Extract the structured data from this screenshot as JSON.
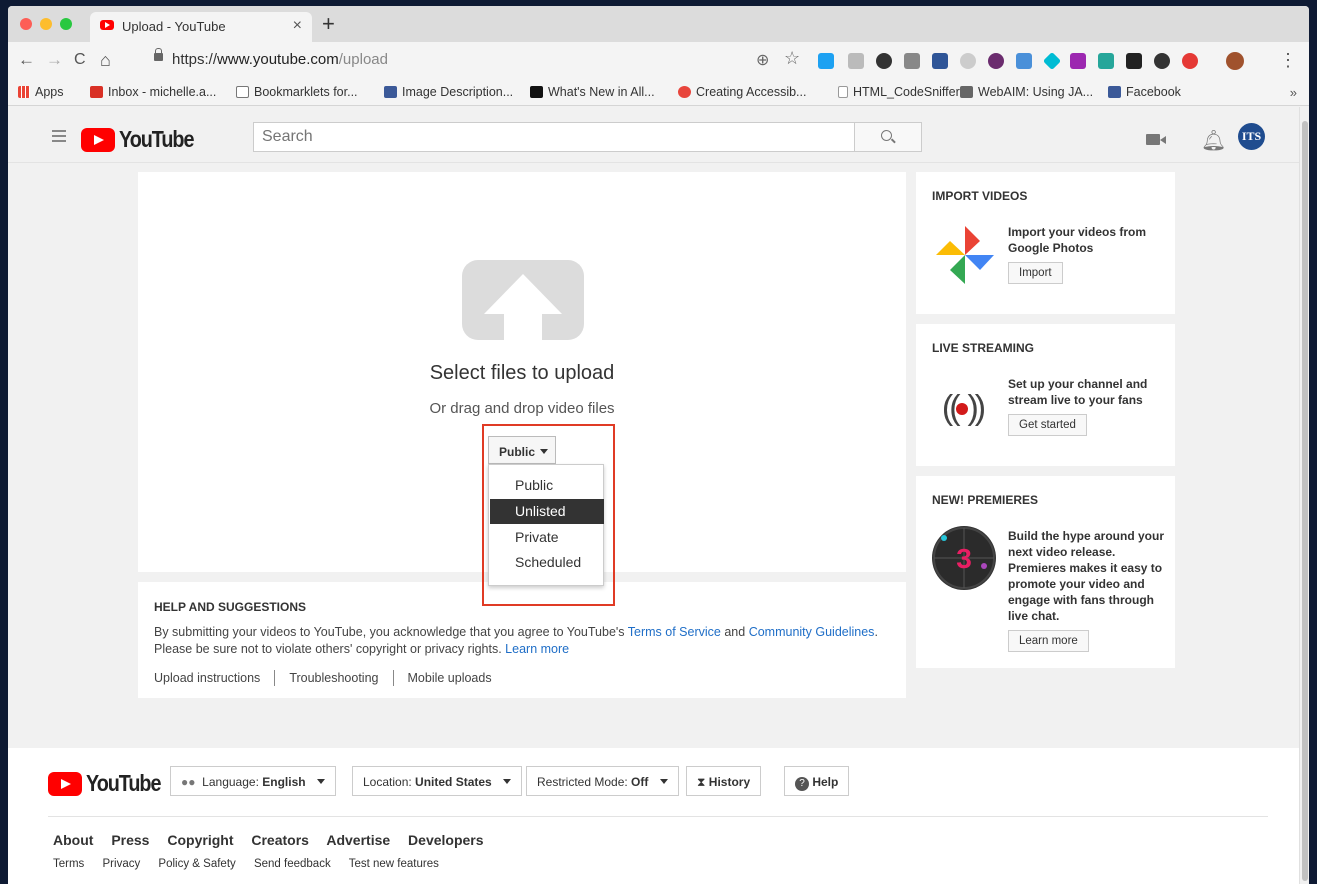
{
  "browser": {
    "tab_title": "Upload - YouTube",
    "tab_close": "×",
    "new_tab": "+",
    "url_scheme": "https://",
    "url_host": "www.youtube.com",
    "url_path": "/upload",
    "nav": {
      "back": "←",
      "forward": "→",
      "reload": "C",
      "home": "⌂"
    },
    "zoom_icon": "⊕",
    "star_icon": "☆",
    "menu_icon": "⋮",
    "bookmarks": [
      {
        "label": "Apps",
        "color": "#f4b400"
      },
      {
        "label": "Inbox - michelle.a...",
        "color": "#d93025"
      },
      {
        "label": "Bookmarklets for...",
        "color": "#888888"
      },
      {
        "label": "Image Description...",
        "color": "#3b5998"
      },
      {
        "label": "What's New in All...",
        "color": "#111111"
      },
      {
        "label": "Creating Accessib...",
        "color": "#e8453c"
      },
      {
        "label": "HTML_CodeSniffer",
        "color": "#aaaaaa"
      },
      {
        "label": "WebAIM: Using JA...",
        "color": "#666666"
      },
      {
        "label": "Facebook",
        "color": "#3b5998"
      }
    ],
    "bookmarks_more": "»"
  },
  "header": {
    "logo_text": "YouTube",
    "search_placeholder": "Search",
    "avatar_initials": "ITS"
  },
  "upload": {
    "title": "Select files to upload",
    "subtitle": "Or drag and drop video files",
    "privacy_selected": "Public",
    "privacy_options": [
      "Public",
      "Unlisted",
      "Private",
      "Scheduled"
    ],
    "highlighted_option": "Unlisted"
  },
  "help": {
    "title": "HELP AND SUGGESTIONS",
    "text_1": "By submitting your videos to YouTube, you acknowledge that you agree to YouTube's ",
    "terms_link": "Terms of Service",
    "text_and": " and ",
    "guidelines_link": "Community Guidelines",
    "text_end": ".",
    "text_2": "Please be sure not to violate others' copyright or privacy rights. ",
    "learn_more": "Learn more",
    "links": [
      "Upload instructions",
      "Troubleshooting",
      "Mobile uploads"
    ]
  },
  "sidebar": {
    "import": {
      "title": "IMPORT VIDEOS",
      "text": "Import your videos from Google Photos",
      "button": "Import"
    },
    "live": {
      "title": "LIVE STREAMING",
      "text": "Set up your channel and stream live to your fans",
      "button": "Get started"
    },
    "premieres": {
      "title": "NEW! PREMIERES",
      "text": "Build the hype around your next video release. Premieres makes it easy to promote your video and engage with fans through live chat.",
      "button": "Learn more",
      "badge_number": "3"
    }
  },
  "footer": {
    "logo_text": "YouTube",
    "language_label": "Language: ",
    "language_value": "English",
    "location_label": "Location: ",
    "location_value": "United States",
    "restricted_label": "Restricted Mode: ",
    "restricted_value": "Off",
    "history": "History",
    "help": "Help",
    "primary_links": [
      "About",
      "Press",
      "Copyright",
      "Creators",
      "Advertise",
      "Developers"
    ],
    "secondary_links": [
      "Terms",
      "Privacy",
      "Policy & Safety",
      "Send feedback",
      "Test new features"
    ]
  },
  "colors": {
    "youtube_red": "#ff0000",
    "link_blue": "#1f6ec7",
    "highlight_red": "#e03b25",
    "selected_bg": "#333333"
  }
}
